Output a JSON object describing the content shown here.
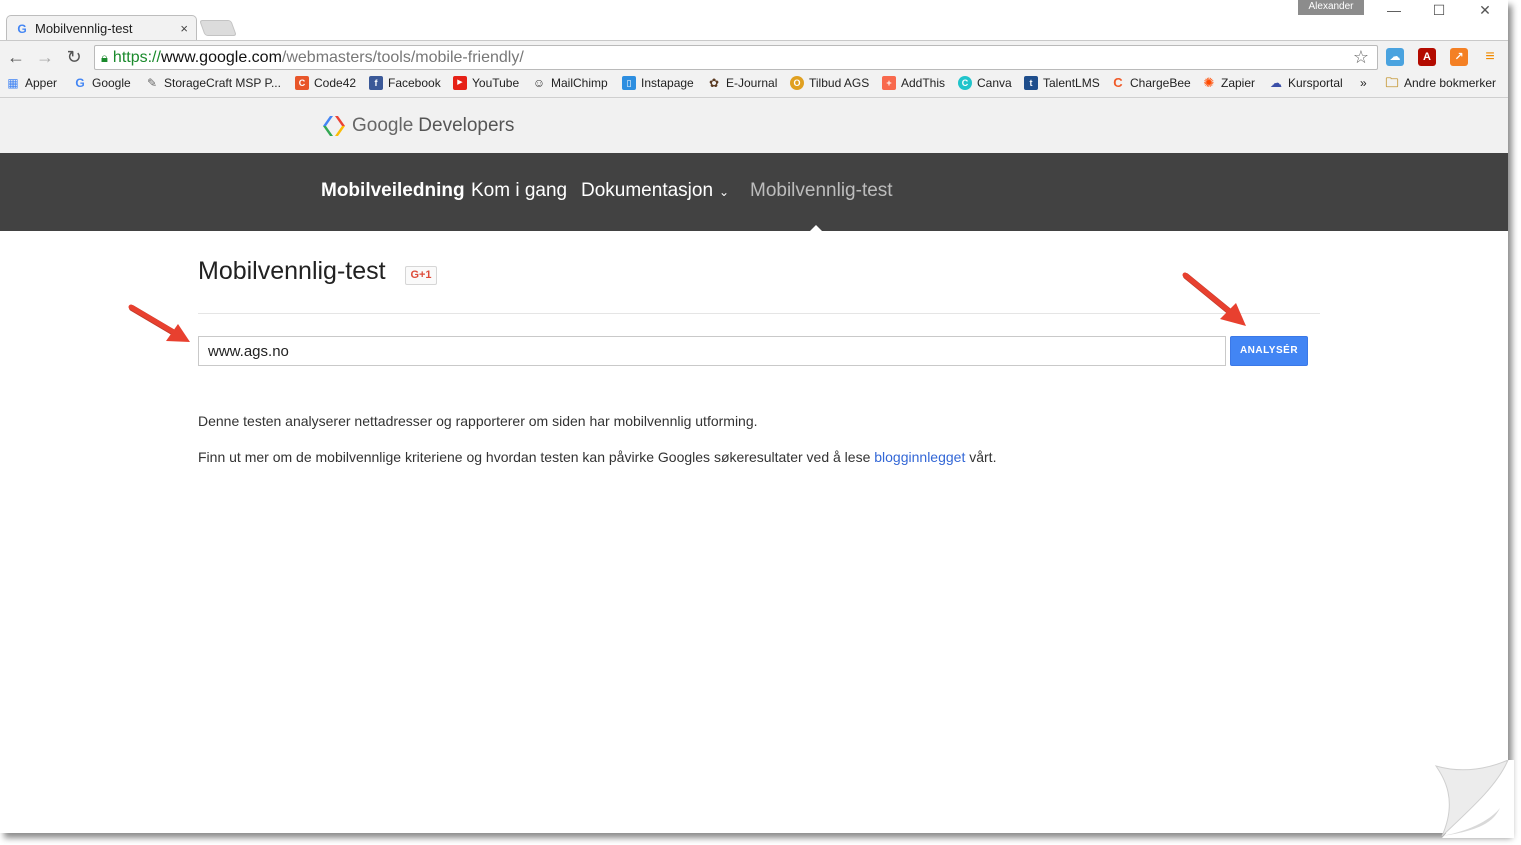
{
  "browser": {
    "tab_title": "Mobilvennlig-test",
    "tab_favicon": "G",
    "tab_close": "×",
    "user_name": "Alexander",
    "url_scheme": "https://",
    "url_host": "www.google.com",
    "url_path": "/webmasters/tools/mobile-friendly/",
    "ext_icons": [
      "onedrive-icon",
      "adobe-pdf-icon",
      "analytics-icon",
      "menu-icon"
    ]
  },
  "bookmarks": [
    {
      "label": "Apper",
      "icon": "apps-grid-icon",
      "color": "#4285f4"
    },
    {
      "label": "Google",
      "icon": "google-icon",
      "color": "#4285f4"
    },
    {
      "label": "StorageCraft MSP P...",
      "icon": "pen-icon",
      "color": "#777777"
    },
    {
      "label": "Code42",
      "icon": "code42-icon",
      "color": "#e8562a"
    },
    {
      "label": "Facebook",
      "icon": "facebook-icon",
      "color": "#3b5998"
    },
    {
      "label": "YouTube",
      "icon": "youtube-icon",
      "color": "#e62117"
    },
    {
      "label": "MailChimp",
      "icon": "mailchimp-icon",
      "color": "#333333"
    },
    {
      "label": "Instapage",
      "icon": "instapage-icon",
      "color": "#2d8ee0"
    },
    {
      "label": "E-Journal",
      "icon": "ejournal-icon",
      "color": "#5a3a22"
    },
    {
      "label": "Tilbud AGS",
      "icon": "tilbud-icon",
      "color": "#e0a020"
    },
    {
      "label": "AddThis",
      "icon": "addthis-icon",
      "color": "#f8694d"
    },
    {
      "label": "Canva",
      "icon": "canva-icon",
      "color": "#20c4cb"
    },
    {
      "label": "TalentLMS",
      "icon": "talentlms-icon",
      "color": "#1f4e8c"
    },
    {
      "label": "ChargeBee",
      "icon": "chargebee-icon",
      "color": "#f05a28"
    },
    {
      "label": "Zapier",
      "icon": "zapier-icon",
      "color": "#ff4a00"
    },
    {
      "label": "Kursportal",
      "icon": "kursportal-icon",
      "color": "#3a4fa8"
    }
  ],
  "bookmarks_more": "»",
  "bookmarks_other": "Andre bokmerker",
  "site": {
    "logo_google": "Google",
    "logo_developers": "Developers",
    "nav": [
      "Mobilveiledning",
      "Kom i gang",
      "Dokumentasjon",
      "Mobilvennlig-test"
    ],
    "nav_caret": "⌄"
  },
  "main": {
    "title": "Mobilvennlig-test",
    "gplus_label": "G+1",
    "url_value": "www.ags.no",
    "analyze_label": "ANALYSÉR",
    "desc1": "Denne testen analyserer nettadresser og rapporterer om siden har mobilvennlig utforming.",
    "desc2_before": "Finn ut mer om de mobilvennlige kriteriene og hvordan testen kan påvirke Googles søkeresultater ved å lese",
    "desc2_link": "blogginnlegget",
    "desc2_after": "vårt."
  },
  "colors": {
    "nav_bg": "#424242",
    "button_blue": "#4285f4",
    "arrow_red": "#e8402f",
    "link_blue": "#3367d6"
  }
}
